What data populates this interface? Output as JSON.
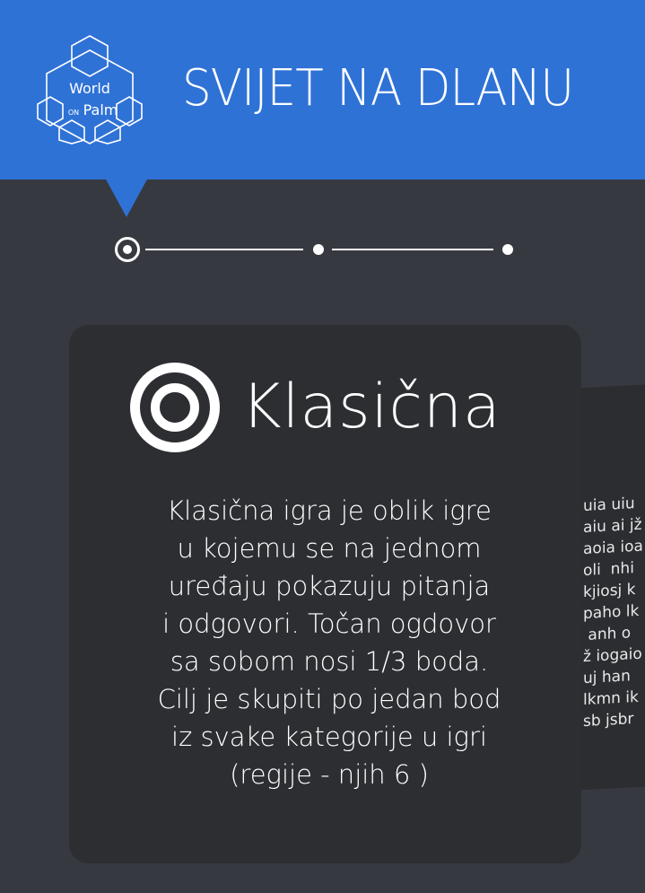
{
  "header": {
    "app_title": "SVIJET NA DLANU",
    "logo": {
      "line1": "World",
      "line2_small": "ON",
      "line2": "Palm"
    },
    "accent_color": "#2f72d6"
  },
  "stepper": {
    "steps": 3,
    "active_step": 1
  },
  "card": {
    "icon": "target-ring-icon",
    "title": "Klasična",
    "description_lines": [
      "Klasična igra je oblik igre",
      "u kojemu se na jednom",
      "uređaju pokazuju pitanja",
      "i odgovori. Točan ogdovor",
      "sa sobom nosi 1/3 boda.",
      "Cilj je skupiti po jedan bod",
      "iz svake kategorije u igri",
      "(regije - njih 6  )"
    ]
  },
  "next_card_preview": {
    "lines": [
      "uia uiu",
      "aiu ai jž",
      "aoia ioa",
      "oli  nhi",
      "kjiosj k",
      "paho lk",
      " anh o",
      "ž iogaio",
      "uj han",
      "lkmn ik",
      "sb jsbr"
    ]
  },
  "colors": {
    "background": "#363940",
    "card": "#2c2e32",
    "text": "#ffffff"
  }
}
